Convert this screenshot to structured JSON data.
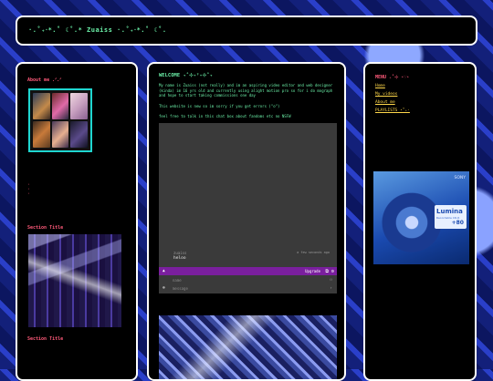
{
  "header": {
    "title": "·.˚₊‧*.˚ ☾˚.* Zuaiss ·.˚₊‧*.˚ ☾˚."
  },
  "left": {
    "about_title": "About me .ᐟ.ᐟ",
    "dots": [
      "·",
      "·",
      "·"
    ],
    "section1_title": "Section Title",
    "section2_title": "Section Title"
  },
  "center": {
    "welcome": "WELCOME ₊˚⊹˖ᵎ˖⊹˚₊",
    "intro": "My name is Zuaiss (not really) and im an aspiring video editor and web designer (kinda) im 16 yrs old and currently using alight motion pro so for i do mograph and hope to start taking commissions one day",
    "note": "This website is new so im sorry if you get errors (\"o\")",
    "chat_invite": "feel free to talk in this chat box about fandoms etc no NSFW",
    "chat": {
      "username": "zuaiss",
      "time": "a few seconds ago",
      "message": "heloo",
      "upgrade_label": "Upgrade",
      "name_placeholder": "name",
      "message_placeholder": "message"
    }
  },
  "right": {
    "menu_title": "MENU ₊˚⊹ ⋆♡⋆",
    "links": [
      "Home",
      "My videos",
      "About me",
      "PLAYLISTS ⋆˚₊·"
    ],
    "cd_brand": "SONY",
    "cd_badge_title": "Lumina",
    "cd_badge_sub": "Recordable CD-R",
    "cd_badge_num": "+80"
  },
  "colors": {
    "accent_green": "#6bf0a8",
    "accent_pink": "#ff5a7a",
    "link_yellow": "#ffd84a",
    "chat_bar": "#7a1f9e"
  }
}
